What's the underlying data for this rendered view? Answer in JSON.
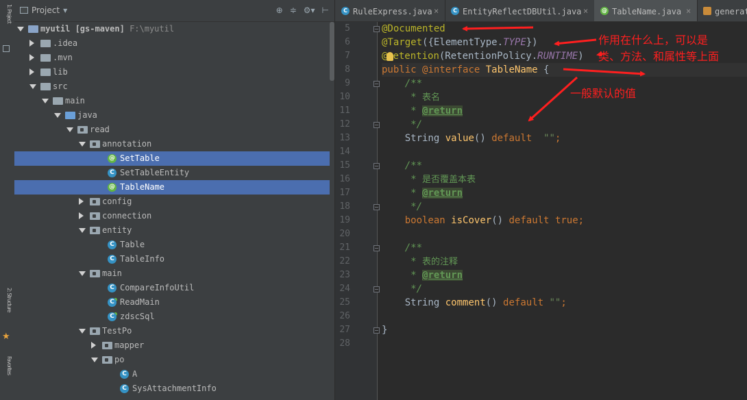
{
  "left_bar": {
    "top_tab": "1: Project",
    "mid_tab": "2: Structure",
    "bottom_tab": "Favorites"
  },
  "project_panel": {
    "title": "Project",
    "tree": [
      {
        "depth": 0,
        "kind": "module",
        "expanded": true,
        "label": "myutil",
        "module": "[gs-maven]",
        "path": "F:\\myutil"
      },
      {
        "depth": 1,
        "kind": "folder",
        "expanded": false,
        "label": ".idea"
      },
      {
        "depth": 1,
        "kind": "folder",
        "expanded": false,
        "label": ".mvn"
      },
      {
        "depth": 1,
        "kind": "folder",
        "expanded": false,
        "label": "lib"
      },
      {
        "depth": 1,
        "kind": "folder",
        "expanded": true,
        "label": "src"
      },
      {
        "depth": 2,
        "kind": "folder",
        "expanded": true,
        "label": "main"
      },
      {
        "depth": 3,
        "kind": "src",
        "expanded": true,
        "label": "java"
      },
      {
        "depth": 4,
        "kind": "pkg",
        "expanded": true,
        "label": "read"
      },
      {
        "depth": 5,
        "kind": "pkg",
        "expanded": true,
        "label": "annotation"
      },
      {
        "depth": 6,
        "kind": "anno",
        "label": "SetTable",
        "selected": true
      },
      {
        "depth": 6,
        "kind": "class",
        "label": "SetTableEntity"
      },
      {
        "depth": 6,
        "kind": "anno",
        "label": "TableName",
        "selected": true
      },
      {
        "depth": 5,
        "kind": "pkg",
        "expanded": false,
        "label": "config"
      },
      {
        "depth": 5,
        "kind": "pkg",
        "expanded": false,
        "label": "connection"
      },
      {
        "depth": 5,
        "kind": "pkg",
        "expanded": true,
        "label": "entity"
      },
      {
        "depth": 6,
        "kind": "class",
        "label": "Table"
      },
      {
        "depth": 6,
        "kind": "class",
        "label": "TableInfo"
      },
      {
        "depth": 5,
        "kind": "pkg",
        "expanded": true,
        "label": "main"
      },
      {
        "depth": 6,
        "kind": "class",
        "label": "CompareInfoUtil"
      },
      {
        "depth": 6,
        "kind": "runclass",
        "label": "ReadMain"
      },
      {
        "depth": 6,
        "kind": "runclass",
        "label": "zdscSql"
      },
      {
        "depth": 5,
        "kind": "pkg",
        "expanded": true,
        "label": "TestPo"
      },
      {
        "depth": 6,
        "kind": "pkg",
        "expanded": false,
        "label": "mapper"
      },
      {
        "depth": 6,
        "kind": "pkg",
        "expanded": true,
        "label": "po"
      },
      {
        "depth": 7,
        "kind": "class",
        "label": "A"
      },
      {
        "depth": 7,
        "kind": "class",
        "label": "SysAttachmentInfo"
      }
    ]
  },
  "editor": {
    "tabs": [
      {
        "label": "RuleExpress.java",
        "icon": "C",
        "active": false
      },
      {
        "label": "EntityReflectDBUtil.java",
        "icon": "C",
        "active": false
      },
      {
        "label": "TableName.java",
        "icon": "@",
        "active": true
      },
      {
        "label": "generat",
        "icon": "xml",
        "active": false
      }
    ],
    "line_numbers": [
      "5",
      "6",
      "7",
      "8",
      "9",
      "10",
      "11",
      "12",
      "13",
      "14",
      "15",
      "16",
      "17",
      "18",
      "19",
      "20",
      "21",
      "22",
      "23",
      "24",
      "25",
      "26",
      "27",
      "28"
    ],
    "code": {
      "l5_anno": "@Documented",
      "l6_anno": "@Target",
      "l6_a": "({ElementType.",
      "l6_type": "TYPE",
      "l6_b": "})",
      "l7_at": "@",
      "l7_anno": "etention",
      "l7_a": "(RetentionPolicy.",
      "l7_runtime": "RUNTIME",
      "l7_b": ")",
      "l8_public": "public",
      "l8_iface": "@interface",
      "l8_name": "TableName",
      "l8_brace": "{",
      "doc_open": "/**",
      "doc_star": "*",
      "doc_close": "*/",
      "doc_return": "@return",
      "doc1_text": "表名",
      "doc2_text": "是否覆盖本表",
      "doc3_text": "表的注释",
      "l13_type": "String",
      "l13_name": "value",
      "l13_parens": "()",
      "l13_default": "default",
      "l13_str": "\"\"",
      "semi": ";",
      "l19_type": "boolean",
      "l19_name": "isCover",
      "l19_parens": "()",
      "l19_default": "default",
      "l19_val": "true",
      "l25_type": "String",
      "l25_name": "comment",
      "l25_parens": "()",
      "l25_default": "default",
      "l25_str": "\"\"",
      "l27_brace": "}"
    }
  },
  "annotations": {
    "note1_line1": "作用在什么上，可以是",
    "note1_line2": "类、方法、和属性等上面",
    "note2": "一般默认的值",
    "color": "#ff1f1f"
  }
}
